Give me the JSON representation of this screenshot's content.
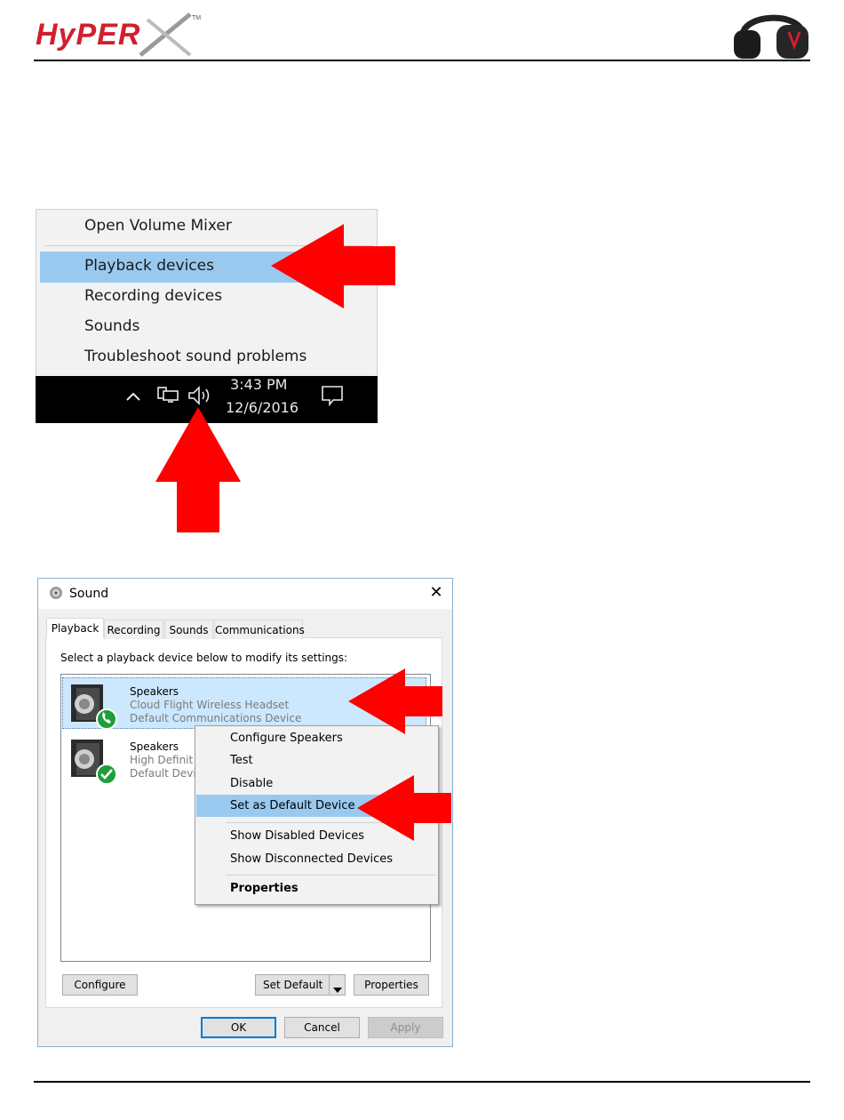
{
  "header": {
    "logo_text": "HyperX"
  },
  "tray_menu": {
    "items": [
      {
        "label": "Open Volume Mixer"
      },
      {
        "label": "Playback devices",
        "highlighted": true
      },
      {
        "label": "Recording devices"
      },
      {
        "label": "Sounds"
      },
      {
        "label": "Troubleshoot sound problems"
      }
    ]
  },
  "taskbar": {
    "time": "3:43 PM",
    "date": "12/6/2016",
    "icons": [
      "chevron-up-icon",
      "network-icon",
      "speaker-icon",
      "action-center-icon"
    ]
  },
  "sound_dialog": {
    "title": "Sound",
    "close_label": "✕",
    "tabs": [
      {
        "label": "Playback",
        "active": true
      },
      {
        "label": "Recording"
      },
      {
        "label": "Sounds"
      },
      {
        "label": "Communications"
      }
    ],
    "instruction": "Select a playback device below to modify its settings:",
    "devices": [
      {
        "name": "Speakers",
        "line2": "Cloud Flight Wireless Headset",
        "line3": "Default Communications Device",
        "badge": "phone-icon",
        "selected": true
      },
      {
        "name": "Speakers",
        "line2": "High Definit",
        "line3": "Default Devi",
        "badge": "check-icon",
        "selected": false
      }
    ],
    "buttons": {
      "configure": "Configure",
      "set_default": "Set Default",
      "properties": "Properties",
      "ok": "OK",
      "cancel": "Cancel",
      "apply": "Apply"
    }
  },
  "device_context_menu": {
    "items": [
      {
        "label": "Configure Speakers"
      },
      {
        "label": "Test"
      },
      {
        "label": "Disable"
      },
      {
        "label": "Set as Default Device",
        "highlighted": true
      },
      {
        "label": "Show Disabled Devices"
      },
      {
        "label": "Show Disconnected Devices"
      },
      {
        "label": "Properties",
        "bold": true
      }
    ]
  },
  "colors": {
    "arrow": "#ff0000",
    "highlight": "#99c9ef",
    "selection": "#cce8ff",
    "green_badge": "#1e9e3a",
    "taskbar": "#000000"
  }
}
